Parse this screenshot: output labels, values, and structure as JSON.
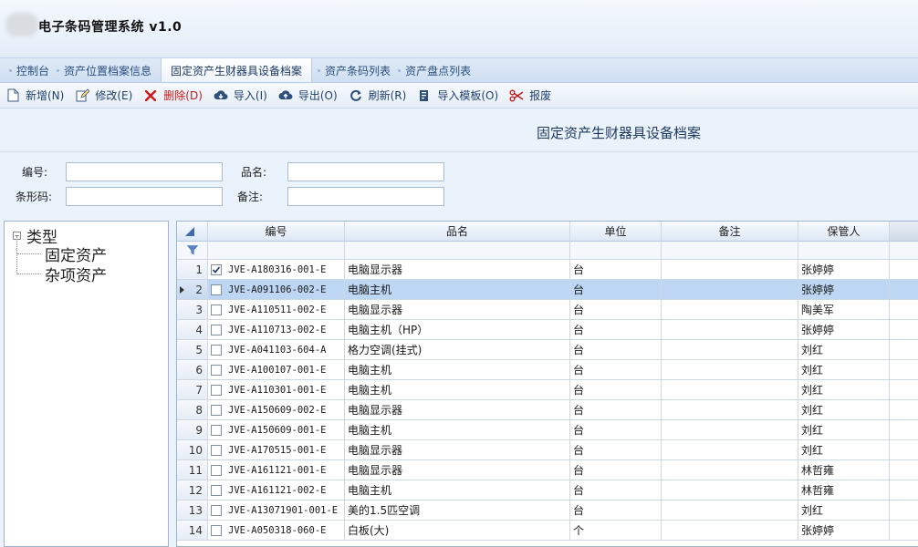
{
  "app": {
    "title": "电子条码管理系统 v1.0"
  },
  "tabs": [
    {
      "label": "控制台",
      "active": false
    },
    {
      "label": "资产位置档案信息",
      "active": false
    },
    {
      "label": "固定资产生财器具设备档案",
      "active": true
    },
    {
      "label": "资产条码列表",
      "active": false
    },
    {
      "label": "资产盘点列表",
      "active": false
    }
  ],
  "toolbar": [
    {
      "label": "新增(N)",
      "icon": "new-document-icon"
    },
    {
      "label": "修改(E)",
      "icon": "edit-icon"
    },
    {
      "label": "删除(D)",
      "icon": "delete-x-icon",
      "color": "#c21b1b"
    },
    {
      "label": "导入(I)",
      "icon": "cloud-download-icon"
    },
    {
      "label": "导出(O)",
      "icon": "cloud-upload-icon"
    },
    {
      "label": "刷新(R)",
      "icon": "refresh-icon"
    },
    {
      "label": "导入模板(O)",
      "icon": "template-icon"
    },
    {
      "label": "报废",
      "icon": "scissors-icon"
    }
  ],
  "page": {
    "title": "固定资产生财器具设备档案"
  },
  "search": {
    "code_label": "编号:",
    "name_label": "品名:",
    "barcode_label": "条形码:",
    "note_label": "备注:",
    "code_value": "",
    "name_value": "",
    "barcode_value": "",
    "note_value": ""
  },
  "tree": {
    "root": "类型",
    "children": [
      "固定资产",
      "杂项资产"
    ]
  },
  "grid": {
    "columns": [
      "编号",
      "品名",
      "单位",
      "备注",
      "保管人"
    ],
    "rows": [
      {
        "n": "1",
        "code": "JVE-A180316-001-E",
        "name": "电脑显示器",
        "unit": "台",
        "note": "",
        "keeper": "张婷婷",
        "checked": true,
        "selected": false
      },
      {
        "n": "2",
        "code": "JVE-A091106-002-E",
        "name": "电脑主机",
        "unit": "台",
        "note": "",
        "keeper": "张婷婷",
        "checked": false,
        "selected": true
      },
      {
        "n": "3",
        "code": "JVE-A110511-002-E",
        "name": "电脑显示器",
        "unit": "台",
        "note": "",
        "keeper": "陶美军",
        "checked": false,
        "selected": false
      },
      {
        "n": "4",
        "code": "JVE-A110713-002-E",
        "name": "电脑主机（HP）",
        "unit": "台",
        "note": "",
        "keeper": "张婷婷",
        "checked": false,
        "selected": false
      },
      {
        "n": "5",
        "code": "JVE-A041103-604-A",
        "name": "格力空调(挂式)",
        "unit": "台",
        "note": "",
        "keeper": "刘红",
        "checked": false,
        "selected": false
      },
      {
        "n": "6",
        "code": "JVE-A100107-001-E",
        "name": "电脑主机",
        "unit": "台",
        "note": "",
        "keeper": "刘红",
        "checked": false,
        "selected": false
      },
      {
        "n": "7",
        "code": "JVE-A110301-001-E",
        "name": "电脑主机",
        "unit": "台",
        "note": "",
        "keeper": "刘红",
        "checked": false,
        "selected": false
      },
      {
        "n": "8",
        "code": "JVE-A150609-002-E",
        "name": "电脑显示器",
        "unit": "台",
        "note": "",
        "keeper": "刘红",
        "checked": false,
        "selected": false
      },
      {
        "n": "9",
        "code": "JVE-A150609-001-E",
        "name": "电脑主机",
        "unit": "台",
        "note": "",
        "keeper": "刘红",
        "checked": false,
        "selected": false
      },
      {
        "n": "10",
        "code": "JVE-A170515-001-E",
        "name": "电脑显示器",
        "unit": "台",
        "note": "",
        "keeper": "刘红",
        "checked": false,
        "selected": false
      },
      {
        "n": "11",
        "code": "JVE-A161121-001-E",
        "name": "电脑显示器",
        "unit": "台",
        "note": "",
        "keeper": "林哲雍",
        "checked": false,
        "selected": false
      },
      {
        "n": "12",
        "code": "JVE-A161121-002-E",
        "name": "电脑主机",
        "unit": "台",
        "note": "",
        "keeper": "林哲雍",
        "checked": false,
        "selected": false
      },
      {
        "n": "13",
        "code": "JVE-A13071901-001-E",
        "name": "美的1.5匹空调",
        "unit": "台",
        "note": "",
        "keeper": "刘红",
        "checked": false,
        "selected": false
      },
      {
        "n": "14",
        "code": "JVE-A050318-060-E",
        "name": "白板(大)",
        "unit": "个",
        "note": "",
        "keeper": "张婷婷",
        "checked": false,
        "selected": false
      }
    ]
  },
  "colors": {
    "accent": "#1f3f6e",
    "selected_row": "#bcd6f3",
    "danger": "#c21b1b"
  }
}
